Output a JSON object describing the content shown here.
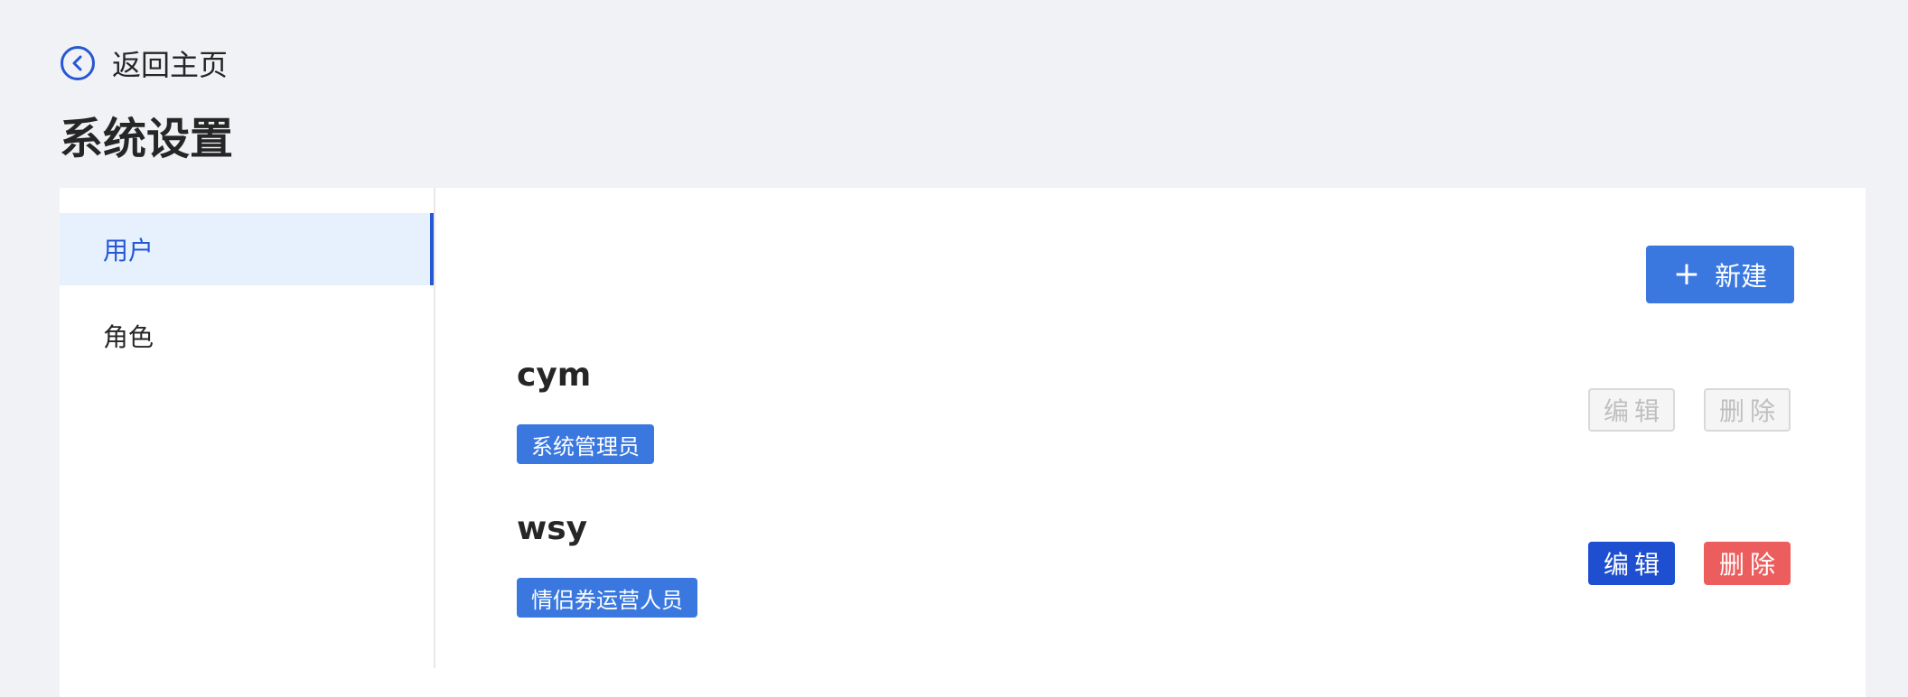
{
  "header": {
    "back_label": "返回主页",
    "back_icon": "chevron-left-circle-icon",
    "title": "系统设置"
  },
  "colors": {
    "accent": "#2557d6",
    "primary_button": "#3a78e0",
    "edit_button": "#1d4fd0",
    "delete_button": "#ec5e5e",
    "active_menu_bg": "#e6f1fd"
  },
  "sidebar": {
    "items": [
      {
        "label": "用户",
        "active": true
      },
      {
        "label": "角色",
        "active": false
      }
    ]
  },
  "toolbar": {
    "new_icon": "plus-icon",
    "new_label": "新建"
  },
  "users": [
    {
      "name": "cym",
      "role": "系统管理员",
      "edit_label": "编辑",
      "delete_label": "删除",
      "actions_enabled": false
    },
    {
      "name": "wsy",
      "role": "情侣券运营人员",
      "edit_label": "编辑",
      "delete_label": "删除",
      "actions_enabled": true
    }
  ]
}
